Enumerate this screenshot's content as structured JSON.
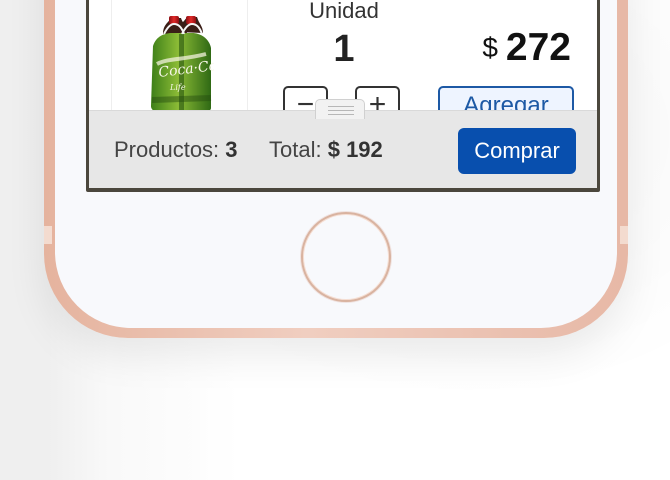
{
  "product": {
    "image_icon": "coca-cola-life-bottle-pack-icon",
    "unit_label": "Unidad",
    "quantity": "1",
    "price_currency": "$",
    "price_amount": "272",
    "minus_label": "−",
    "plus_label": "+",
    "add_label": "Agregar"
  },
  "footer": {
    "products_label": "Productos:",
    "products_count": "3",
    "total_label": "Total:",
    "total_value": "$ 192",
    "buy_label": "Comprar",
    "drag_handle_icon": "drag-handle-icon"
  },
  "device": {
    "home_button_icon": "home-button-icon"
  },
  "colors": {
    "primary_blue": "#084fae",
    "phone_rose_gold": "#e7b8a6",
    "footer_gray": "#e7e7e7"
  }
}
